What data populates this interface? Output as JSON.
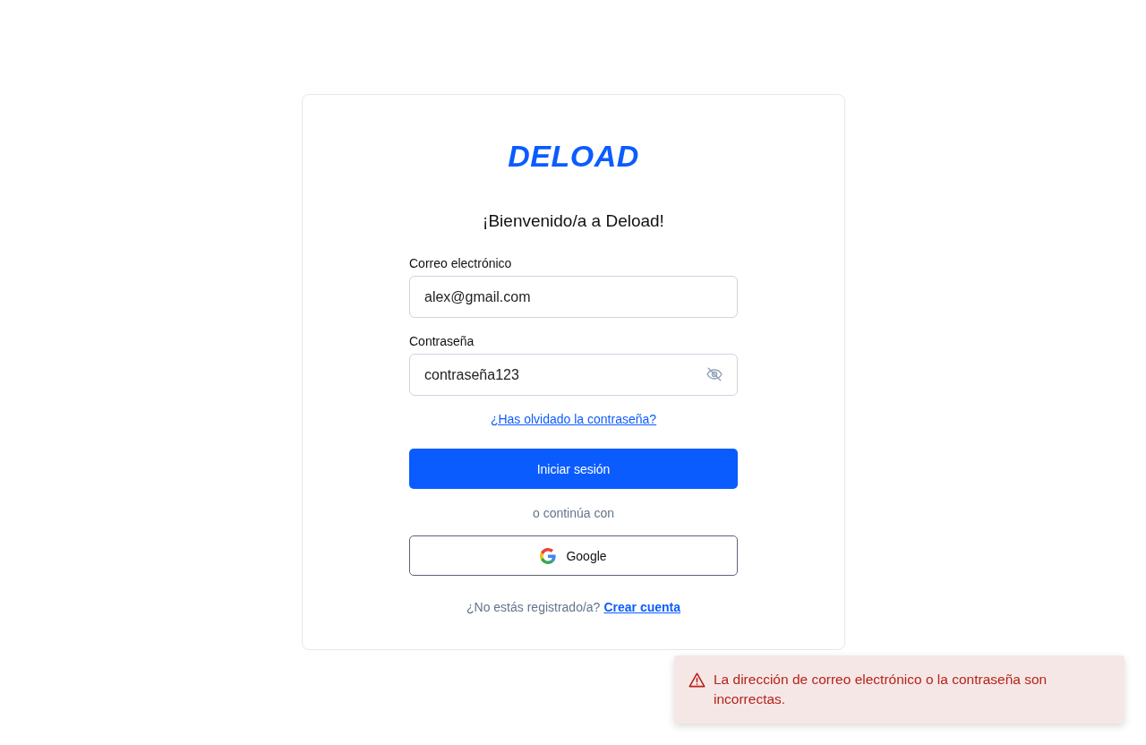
{
  "logo": {
    "text": "DELOAD"
  },
  "heading": "¡Bienvenido/a a Deload!",
  "email": {
    "label": "Correo electrónico",
    "value": "alex@gmail.com"
  },
  "password": {
    "label": "Contraseña",
    "value": "contraseña123",
    "revealed": true
  },
  "forgot_link": "¿Has olvidado la contraseña?",
  "submit_button": "Iniciar sesión",
  "divider_text": "o continúa con",
  "social_button": {
    "label": "Google"
  },
  "signup": {
    "prompt": "¿No estás registrado/a?",
    "link": "Crear cuenta"
  },
  "toast": {
    "kind": "error",
    "message": "La dirección de correo electrónico o la contraseña son incorrectas."
  }
}
